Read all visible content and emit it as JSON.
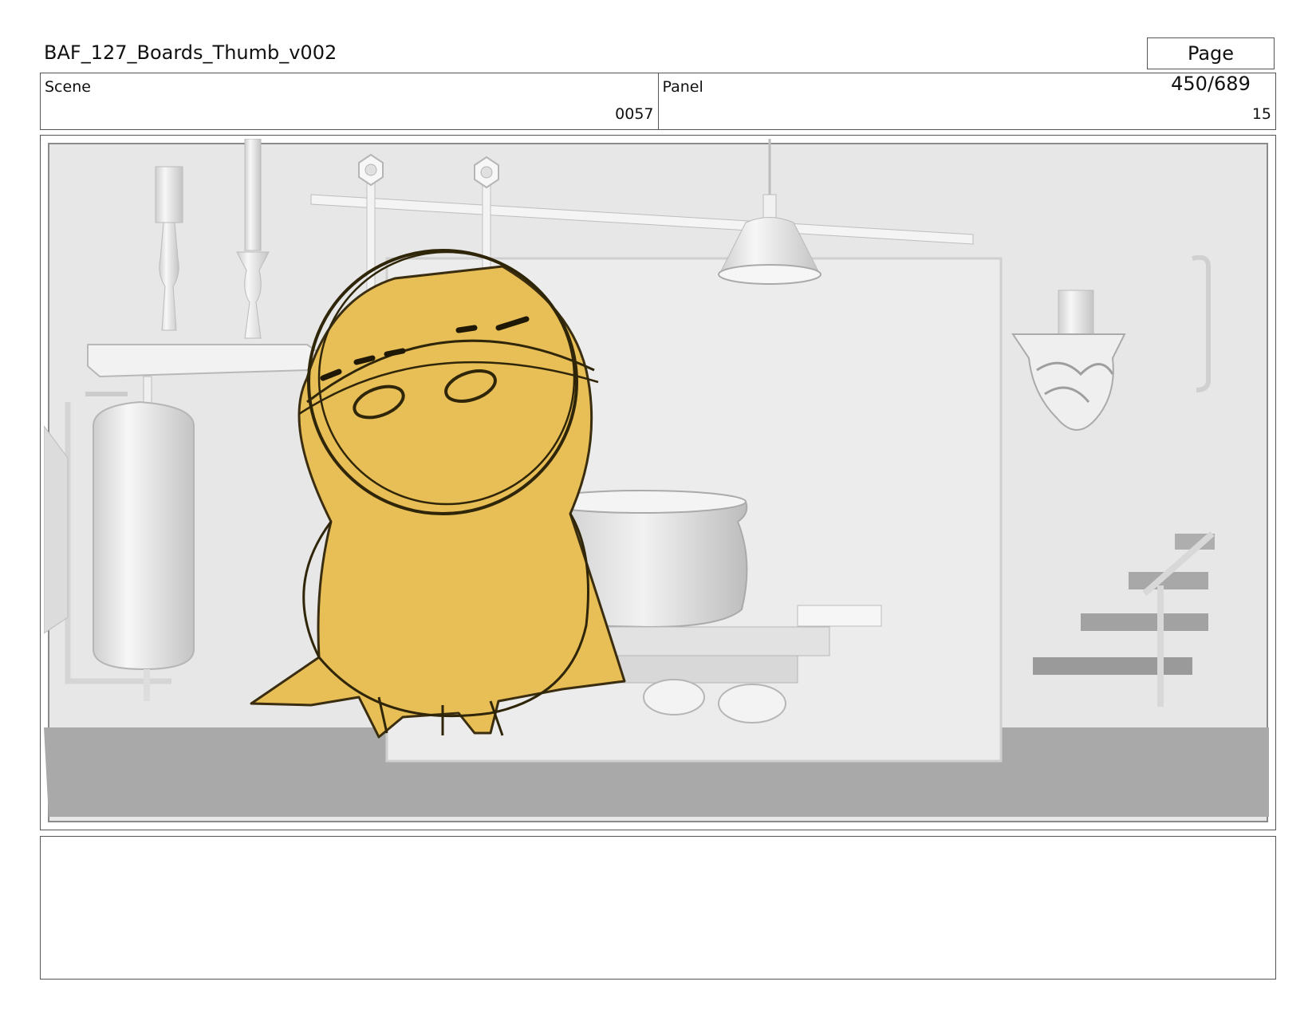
{
  "header": {
    "document_title": "BAF_127_Boards_Thumb_v002",
    "page_indicator": "Page 450/689"
  },
  "info": {
    "scene_label": "Scene",
    "scene_value": "0057",
    "panel_label": "Panel",
    "panel_value": "15"
  },
  "panel_image": {
    "description_icon": "storyboard-frame",
    "character_color": "#E8BF57",
    "background_color": "#E6E6E6",
    "floor_color": "#A9A9A9"
  },
  "notes": {
    "text": ""
  }
}
